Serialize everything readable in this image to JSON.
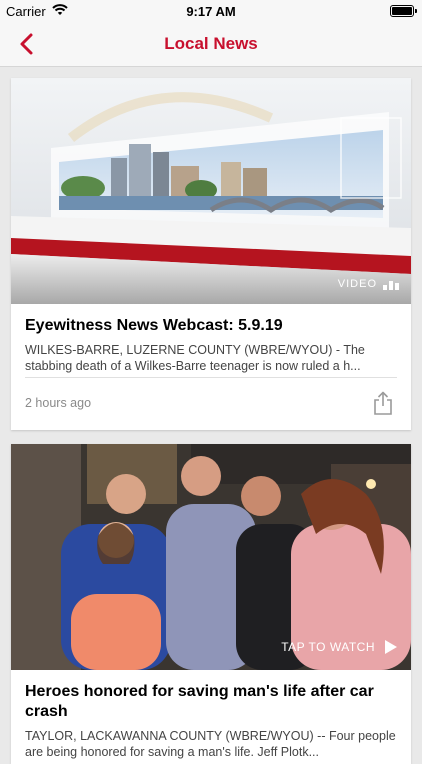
{
  "status_bar": {
    "carrier": "Carrier",
    "time": "9:17 AM"
  },
  "nav": {
    "title": "Local News",
    "back_icon": "chevron-left-icon"
  },
  "colors": {
    "brand_red": "#c8102e",
    "background": "#e9e9e9"
  },
  "articles": [
    {
      "headline": "Eyewitness News Webcast: 5.9.19",
      "summary": "WILKES-BARRE, LUZERNE COUNTY (WBRE/WYOU) - The stabbing death of a Wilkes-Barre teenager is now ruled a h...",
      "age": "2 hours ago",
      "badge": "VIDEO",
      "share_icon": "share-icon"
    },
    {
      "headline": "Heroes honored for saving man's life after car crash",
      "summary": "TAYLOR, LACKAWANNA COUNTY (WBRE/WYOU) -- Four people are being honored for saving a man's life. Jeff Plotk...",
      "badge": "TAP TO WATCH"
    }
  ]
}
